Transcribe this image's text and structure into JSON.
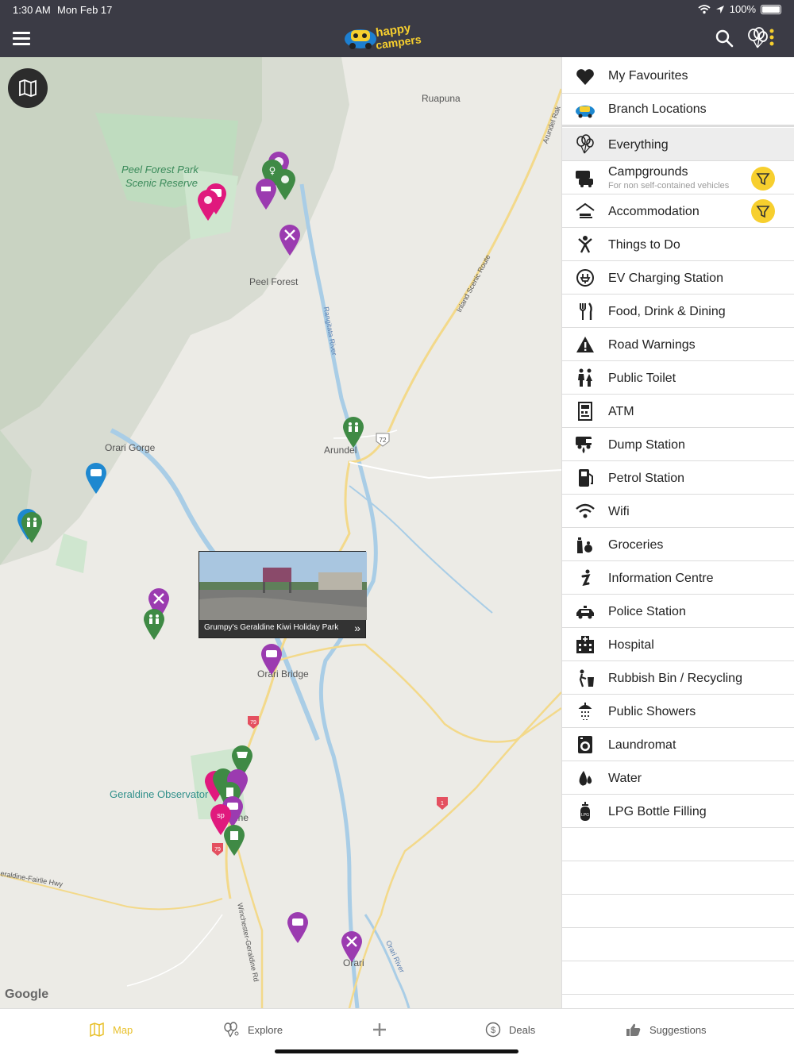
{
  "status": {
    "time": "1:30 AM",
    "date": "Mon Feb 17",
    "battery": "100%"
  },
  "header": {
    "logo_top": "happy",
    "logo_bottom": "campers"
  },
  "map": {
    "labels": [
      {
        "text": "Ruapuna"
      },
      {
        "text": "Peel Forest Park"
      },
      {
        "text": "Scenic Reserve"
      },
      {
        "text": "Peel Forest"
      },
      {
        "text": "Orari Gorge"
      },
      {
        "text": "Arundel"
      },
      {
        "text": "Orari Bridge"
      },
      {
        "text": "Geraldine Observator"
      },
      {
        "text": "ine"
      },
      {
        "text": "eraldine-Fairlie Hwy"
      },
      {
        "text": "Winchester-Geraldine Rd"
      },
      {
        "text": "Orari"
      },
      {
        "text": "Inland Scenic Route"
      },
      {
        "text": "Arundel Rak"
      },
      {
        "text": "Rangitata River"
      },
      {
        "text": "Orari River"
      }
    ],
    "shields": [
      "72",
      "79",
      "79",
      "1"
    ],
    "callout_title": "Grumpy's Geraldine Kiwi Holiday Park",
    "callout_chevron": "»",
    "google": "Google"
  },
  "panel": {
    "items": [
      {
        "label": "My Favourites",
        "icon": "heart-icon"
      },
      {
        "label": "Branch Locations",
        "icon": "campervan-logo-icon"
      },
      {
        "label": "Everything",
        "icon": "balloons-icon",
        "selected": true
      },
      {
        "label": "Campgrounds",
        "sublabel": "For non self-contained vehicles",
        "icon": "campground-icon",
        "filter": true
      },
      {
        "label": "Accommodation",
        "icon": "accommodation-icon",
        "filter": true
      },
      {
        "label": "Things to Do",
        "icon": "activity-icon"
      },
      {
        "label": "EV Charging Station",
        "icon": "ev-charging-icon"
      },
      {
        "label": "Food, Drink & Dining",
        "icon": "cutlery-icon"
      },
      {
        "label": "Road Warnings",
        "icon": "warning-icon"
      },
      {
        "label": "Public Toilet",
        "icon": "toilet-icon"
      },
      {
        "label": "ATM",
        "icon": "atm-icon"
      },
      {
        "label": "Dump Station",
        "icon": "dump-station-icon"
      },
      {
        "label": "Petrol Station",
        "icon": "petrol-icon"
      },
      {
        "label": "Wifi",
        "icon": "wifi-icon"
      },
      {
        "label": "Groceries",
        "icon": "groceries-icon"
      },
      {
        "label": "Information Centre",
        "icon": "info-icon"
      },
      {
        "label": "Police Station",
        "icon": "police-car-icon"
      },
      {
        "label": "Hospital",
        "icon": "hospital-icon"
      },
      {
        "label": "Rubbish Bin / Recycling",
        "icon": "rubbish-bin-icon"
      },
      {
        "label": "Public Showers",
        "icon": "shower-icon"
      },
      {
        "label": "Laundromat",
        "icon": "washing-machine-icon"
      },
      {
        "label": "Water",
        "icon": "water-drop-icon"
      },
      {
        "label": "LPG Bottle Filling",
        "icon": "lpg-bottle-icon"
      }
    ]
  },
  "tabs": [
    {
      "label": "Map",
      "icon": "map-icon",
      "active": true
    },
    {
      "label": "Explore",
      "icon": "explore-icon"
    },
    {
      "label": "",
      "icon": "plus-icon"
    },
    {
      "label": "Deals",
      "icon": "dollar-icon"
    },
    {
      "label": "Suggestions",
      "icon": "thumbs-up-icon"
    }
  ],
  "colors": {
    "header_bg": "#3b3b45",
    "accent_yellow": "#f7cf2e",
    "pin_purple": "#9b3bb0",
    "pin_green": "#3f8a45",
    "pin_pink": "#e0197d",
    "pin_blue": "#1e88d0"
  }
}
